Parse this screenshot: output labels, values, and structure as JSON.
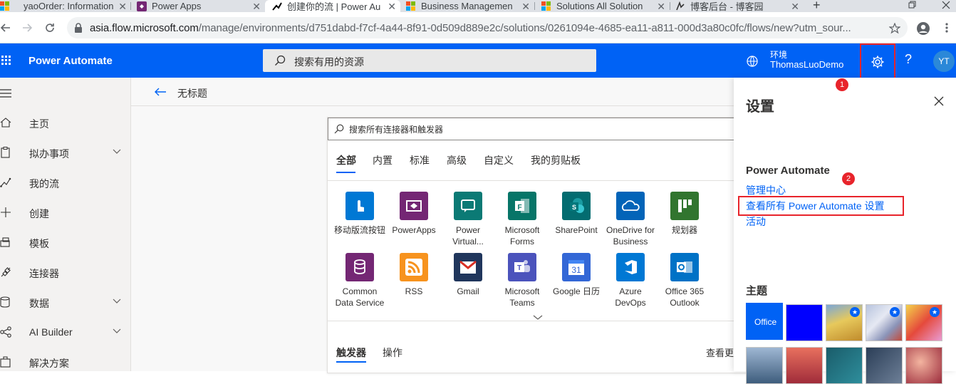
{
  "browser": {
    "tabs": [
      {
        "title": "yaoOrder: Information"
      },
      {
        "title": "Power Apps"
      },
      {
        "title": "创建你的流 | Power Au"
      },
      {
        "title": "Business Managemen"
      },
      {
        "title": "Solutions All Solution"
      },
      {
        "title": "博客后台 - 博客园"
      }
    ],
    "new_tab": "+",
    "close": "✕",
    "url_host": "asia.flow.microsoft.com",
    "url_path": "/manage/environments/d751dabd-f7cf-4a44-8f91-0d509d889e2c/solutions/0261094e-4685-ea11-a811-000d3a80c0fc/flows/new?utm_sour..."
  },
  "header": {
    "brand": "Power Automate",
    "search_placeholder": "搜索有用的资源",
    "env_label": "环境",
    "env_name": "ThomasLuoDemo",
    "help": "?",
    "avatar": "YT"
  },
  "nav": {
    "items": [
      {
        "label": "主页"
      },
      {
        "label": "拟办事项"
      },
      {
        "label": "我的流"
      },
      {
        "label": "创建"
      },
      {
        "label": "模板"
      },
      {
        "label": "连接器"
      },
      {
        "label": "数据"
      },
      {
        "label": "AI Builder"
      },
      {
        "label": "解决方案"
      }
    ]
  },
  "main": {
    "page_title": "无标题",
    "connector_search": "搜索所有连接器和触发器",
    "tabs": [
      "全部",
      "内置",
      "标准",
      "高级",
      "自定义",
      "我的剪贴板"
    ],
    "connectors": [
      {
        "name": "移动版流按钮",
        "color": "#0078d4"
      },
      {
        "name": "PowerApps",
        "color": "#742774"
      },
      {
        "name": "Power Virtual...",
        "color": "#0b7a75"
      },
      {
        "name": "Microsoft Forms",
        "color": "#077568"
      },
      {
        "name": "SharePoint",
        "color": "#036c70"
      },
      {
        "name": "OneDrive for Business",
        "color": "#0364b8"
      },
      {
        "name": "规划器",
        "color": "#31752f"
      },
      {
        "name": "Common Data Service",
        "color": "#742774"
      },
      {
        "name": "RSS",
        "color": "#f7931e"
      },
      {
        "name": "Gmail",
        "color": "#20365c"
      },
      {
        "name": "Microsoft Teams",
        "color": "#4b53bc"
      },
      {
        "name": "Google 日历",
        "color": "#3367d6"
      },
      {
        "name": "Azure DevOps",
        "color": "#0078d4"
      },
      {
        "name": "Office 365 Outlook",
        "color": "#0072c6"
      }
    ],
    "bottom_tabs": [
      "触发器",
      "操作"
    ],
    "see_more": "查看更多"
  },
  "settings_panel": {
    "title": "设置",
    "section": "Power Automate",
    "links": [
      "管理中心",
      "查看所有 Power Automate 设置",
      "活动"
    ],
    "theme_title": "主题",
    "themes": [
      {
        "name": "Office",
        "color": "#0062f5"
      },
      {
        "name": "",
        "color": "#0000ff"
      },
      {
        "name": "",
        "color": "#c9b25a"
      },
      {
        "name": "",
        "color": "#9aa6c8"
      },
      {
        "name": "",
        "color": "#e54a3c"
      }
    ],
    "badge1": "1",
    "badge2": "2"
  }
}
